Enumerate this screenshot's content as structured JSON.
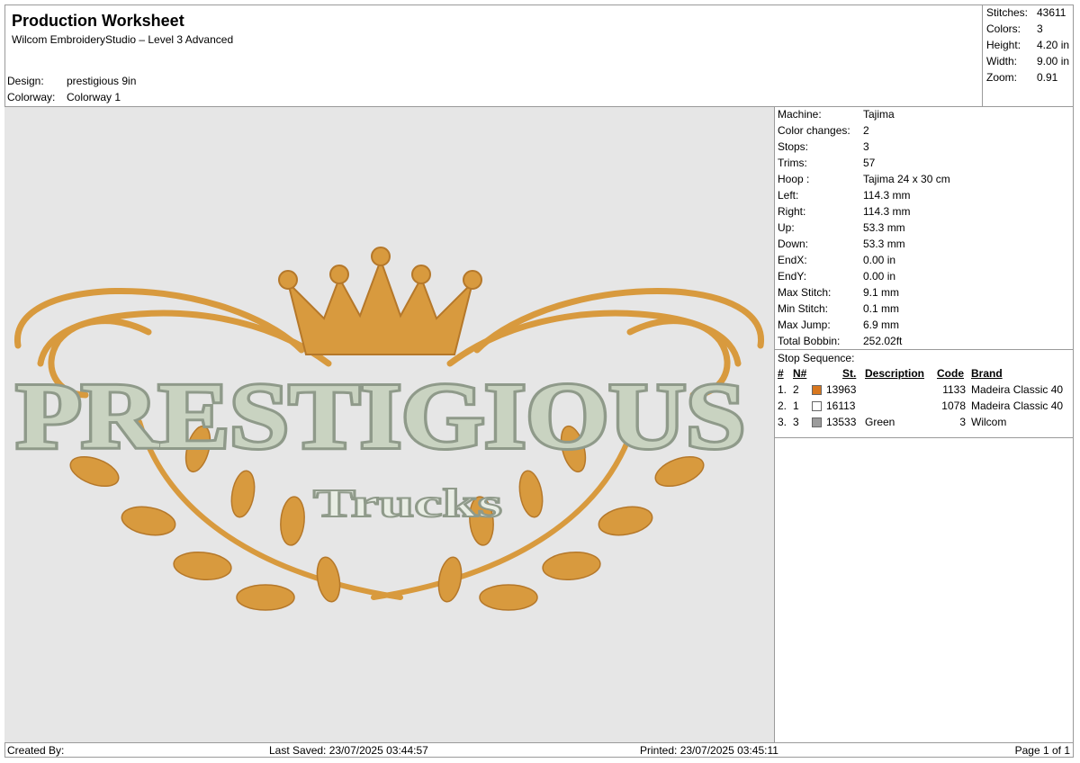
{
  "header": {
    "title": "Production Worksheet",
    "subtitle": "Wilcom EmbroideryStudio – Level 3 Advanced",
    "design_label": "Design:",
    "design_value": "prestigious 9in",
    "colorway_label": "Colorway:",
    "colorway_value": "Colorway 1"
  },
  "stats": [
    {
      "label": "Stitches:",
      "value": "43611"
    },
    {
      "label": "Colors:",
      "value": "3"
    },
    {
      "label": "Height:",
      "value": "4.20 in"
    },
    {
      "label": "Width:",
      "value": "9.00 in"
    },
    {
      "label": "Zoom:",
      "value": "0.91"
    }
  ],
  "machine": [
    {
      "label": "Machine:",
      "value": "Tajima"
    },
    {
      "label": "Color changes:",
      "value": "2"
    },
    {
      "label": "Stops:",
      "value": "3"
    },
    {
      "label": "Trims:",
      "value": "57"
    },
    {
      "label": "Hoop :",
      "value": "Tajima 24 x 30 cm"
    },
    {
      "label": "Left:",
      "value": "114.3 mm"
    },
    {
      "label": "Right:",
      "value": "114.3 mm"
    },
    {
      "label": "Up:",
      "value": "53.3 mm"
    },
    {
      "label": "Down:",
      "value": "53.3 mm"
    },
    {
      "label": "EndX:",
      "value": "0.00 in"
    },
    {
      "label": "EndY:",
      "value": "0.00 in"
    },
    {
      "label": "Max Stitch:",
      "value": "9.1 mm"
    },
    {
      "label": "Min Stitch:",
      "value": "0.1 mm"
    },
    {
      "label": "Max Jump:",
      "value": "6.9 mm"
    },
    {
      "label": "Total Bobbin:",
      "value": "252.02ft"
    }
  ],
  "stop_sequence": {
    "label": "Stop Sequence:",
    "headers": {
      "num": "#",
      "n": "N#",
      "st": "St.",
      "description": "Description",
      "code": "Code",
      "brand": "Brand"
    },
    "rows": [
      {
        "num": "1.",
        "n": "2",
        "color": "#d8771e",
        "st": "13963",
        "description": "",
        "code": "1133",
        "brand": "Madeira Classic 40"
      },
      {
        "num": "2.",
        "n": "1",
        "color": "#ffffff",
        "st": "16113",
        "description": "",
        "code": "1078",
        "brand": "Madeira Classic 40"
      },
      {
        "num": "3.",
        "n": "3",
        "color": "#9b9b9b",
        "st": "13533",
        "description": "Green",
        "code": "3",
        "brand": "Wilcom"
      }
    ]
  },
  "design_preview": {
    "main_text": "PRESTIGIOUS",
    "sub_text": "Trucks",
    "gold": "#d89a3e",
    "silver": "#c9d3c1",
    "outline": "#8f9a8a",
    "background": "#e6e6e6"
  },
  "footer": {
    "created_by": "Created By:",
    "last_saved": "Last Saved: 23/07/2025 03:44:57",
    "printed": "Printed: 23/07/2025 03:45:11",
    "page": "Page 1 of 1"
  }
}
